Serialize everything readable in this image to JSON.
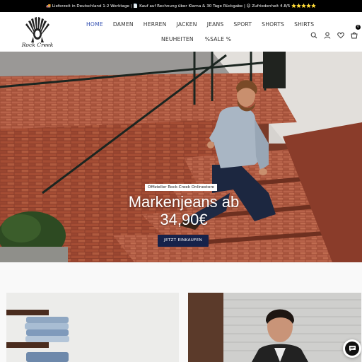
{
  "topbar": {
    "text": "🚚 Lieferzeit in Deutschland 1-2 Werktage | 📄 Kauf auf Rechnung über Klarna & 30 Tage Rückgabe | 😊 Zufriedenheit 4.8/5 ⭐⭐⭐⭐⭐"
  },
  "header": {
    "logo_text": "Rock  Creek",
    "nav_row1": [
      "HOME",
      "DAMEN",
      "HERREN",
      "JACKEN",
      "JEANS",
      "SPORT",
      "SHORTS",
      "SHIRTS"
    ],
    "nav_row2": [
      "NEUHEITEN",
      "%SALE %"
    ],
    "active_item": "HOME",
    "icons": [
      "search-icon",
      "user-icon",
      "heart-icon",
      "cart-icon"
    ],
    "cart_count": "0"
  },
  "hero": {
    "badge": "Offizieller Rock-Creek Onlinestore",
    "title_line1": "Markenjeans ab",
    "title_line2": "34,90€",
    "cta": "JETZT EINKAUFEN"
  },
  "colors": {
    "accent": "#3451b2",
    "cta_bg": "#16224a",
    "topbar_bg": "#000000"
  },
  "chat": {
    "icon": "chat-icon"
  }
}
